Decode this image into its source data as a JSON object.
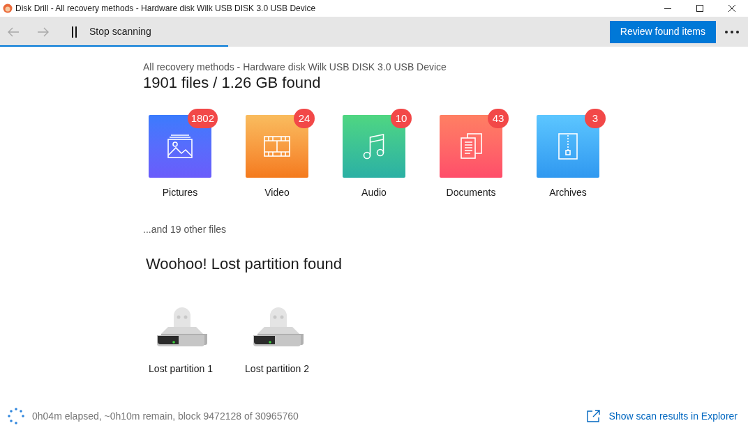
{
  "window": {
    "title": "Disk Drill - All recovery methods - Hardware disk Wilk USB DISK 3.0 USB Device"
  },
  "toolbar": {
    "stop_label": "Stop scanning",
    "review_button": "Review found items",
    "progress": {
      "level": 0.305
    }
  },
  "header": {
    "subtitle": "All recovery methods - Hardware disk Wilk USB DISK 3.0 USB Device",
    "title": "1901 files / 1.26 GB found"
  },
  "categories": [
    {
      "kind": "pictures",
      "label": "Pictures",
      "count": "1802"
    },
    {
      "kind": "video",
      "label": "Video",
      "count": "24"
    },
    {
      "kind": "audio",
      "label": "Audio",
      "count": "10"
    },
    {
      "kind": "documents",
      "label": "Documents",
      "count": "43"
    },
    {
      "kind": "archives",
      "label": "Archives",
      "count": "3"
    }
  ],
  "other_files": "...and 19 other files",
  "partitions": {
    "title": "Woohoo! Lost partition found",
    "items": [
      {
        "label": "Lost partition 1"
      },
      {
        "label": "Lost partition 2"
      }
    ]
  },
  "status_bar": {
    "text": "0h04m elapsed, ~0h10m remain, block 9472128 of 30965760",
    "link": "Show scan results in Explorer"
  }
}
